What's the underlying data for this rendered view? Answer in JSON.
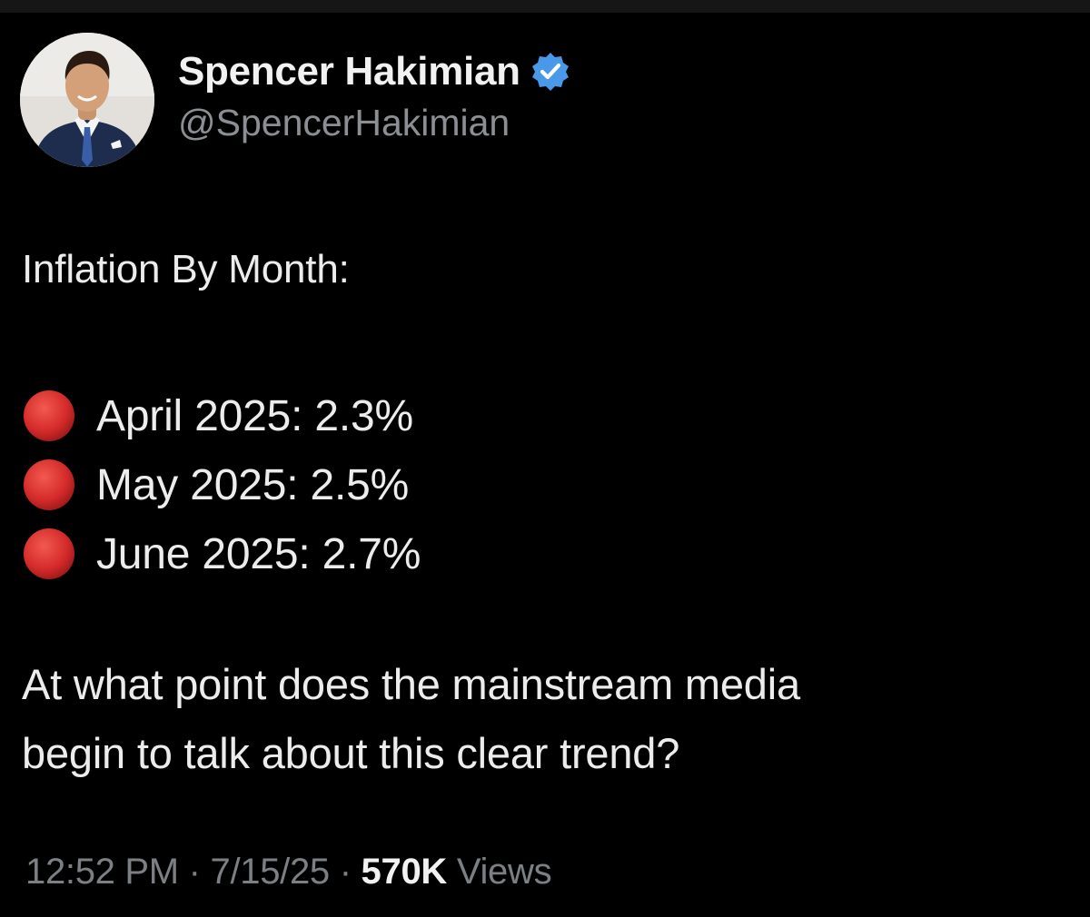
{
  "author": {
    "display_name": "Spencer Hakimian",
    "handle": "@SpencerHakimian",
    "verified": true,
    "verified_badge_color": "#4a99e9"
  },
  "tweet": {
    "headline": "Inflation By Month:",
    "bullets": [
      {
        "icon": "red-circle-icon",
        "text": "April 2025: 2.3%"
      },
      {
        "icon": "red-circle-icon",
        "text": "May 2025: 2.5%"
      },
      {
        "icon": "red-circle-icon",
        "text": "June 2025: 2.7%"
      }
    ],
    "question_lines": [
      "At what point does the mainstream media",
      "begin to talk about this clear trend?"
    ]
  },
  "meta": {
    "time": "12:52 PM",
    "separator": "·",
    "date": "7/15/25",
    "views_count": "570K",
    "views_label": "Views"
  },
  "colors": {
    "background": "#000000",
    "primary_text": "#ececec",
    "secondary_text": "#8b8f94",
    "bullet_red": "#d42a2a"
  }
}
